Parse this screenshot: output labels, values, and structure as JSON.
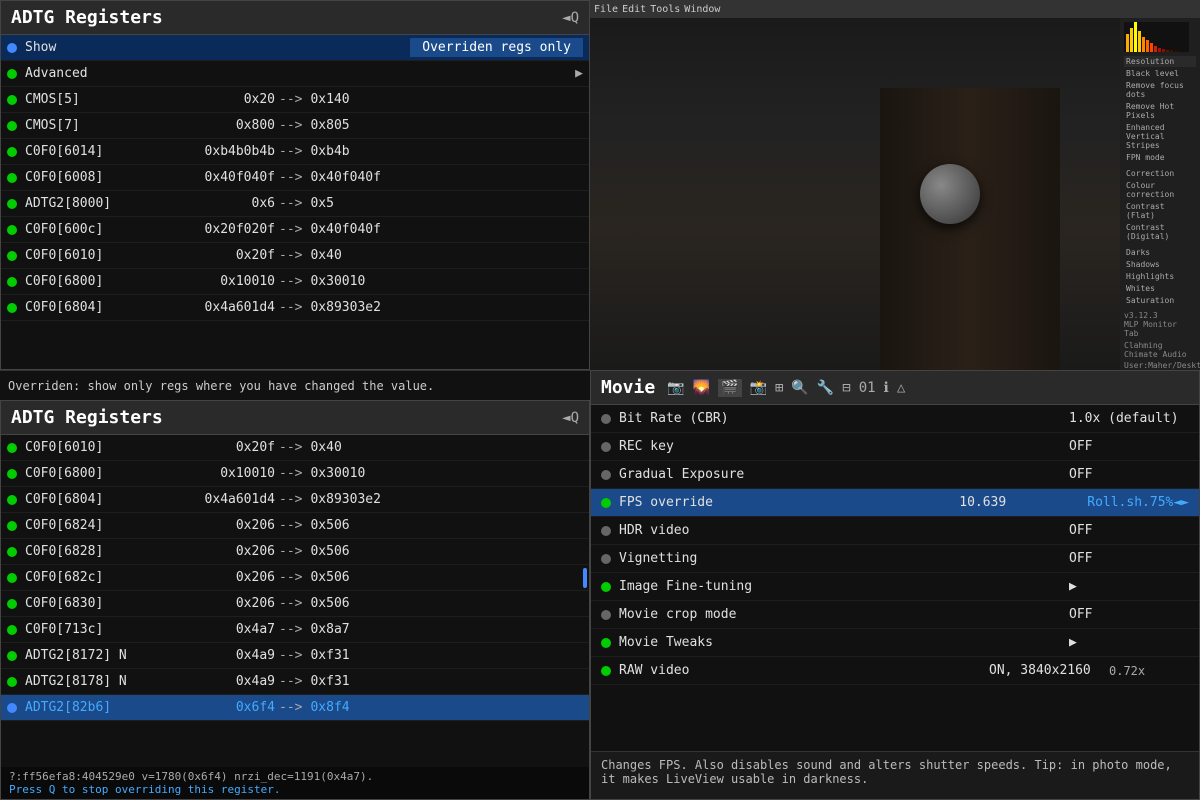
{
  "topLeft": {
    "title": "ADTG Registers",
    "icon": "◄Q",
    "showLabel": "Show",
    "showValue": "Overriden regs only",
    "advancedLabel": "Advanced",
    "registers": [
      {
        "dot": "green",
        "name": "CMOS[5]",
        "value": "0x20",
        "arrow": "-->",
        "override": "0x140"
      },
      {
        "dot": "green",
        "name": "CMOS[7]",
        "value": "0x800",
        "arrow": "-->",
        "override": "0x805"
      },
      {
        "dot": "green",
        "name": "C0F0[6014]",
        "value": "0xb4b0b4b",
        "arrow": "-->",
        "override": "0xb4b"
      },
      {
        "dot": "green",
        "name": "C0F0[6008]",
        "value": "0x40f040f",
        "arrow": "-->",
        "override": "0x40f040f"
      },
      {
        "dot": "green",
        "name": "ADTG2[8000]",
        "value": "0x6",
        "arrow": "-->",
        "override": "0x5"
      },
      {
        "dot": "green",
        "name": "C0F0[600c]",
        "value": "0x20f020f",
        "arrow": "-->",
        "override": "0x40f040f"
      },
      {
        "dot": "green",
        "name": "C0F0[6010]",
        "value": "0x20f",
        "arrow": "-->",
        "override": "0x40"
      },
      {
        "dot": "green",
        "name": "C0F0[6800]",
        "value": "0x10010",
        "arrow": "-->",
        "override": "0x30010"
      },
      {
        "dot": "green",
        "name": "C0F0[6804]",
        "value": "0x4a601d4",
        "arrow": "-->",
        "override": "0x89303e2"
      }
    ]
  },
  "statusBar": {
    "text": "Overriden: show only regs where you have changed the value."
  },
  "bottomLeft": {
    "title": "ADTG Registers",
    "icon": "◄Q",
    "registers": [
      {
        "dot": "green",
        "name": "C0F0[6010]",
        "value": "0x20f",
        "arrow": "-->",
        "override": "0x40"
      },
      {
        "dot": "green",
        "name": "C0F0[6800]",
        "value": "0x10010",
        "arrow": "-->",
        "override": "0x30010"
      },
      {
        "dot": "green",
        "name": "C0F0[6804]",
        "value": "0x4a601d4",
        "arrow": "-->",
        "override": "0x89303e2"
      },
      {
        "dot": "green",
        "name": "C0F0[6824]",
        "value": "0x206",
        "arrow": "-->",
        "override": "0x506"
      },
      {
        "dot": "green",
        "name": "C0F0[6828]",
        "value": "0x206",
        "arrow": "-->",
        "override": "0x506"
      },
      {
        "dot": "green",
        "name": "C0F0[682c]",
        "value": "0x206",
        "arrow": "-->",
        "override": "0x506"
      },
      {
        "dot": "green",
        "name": "C0F0[6830]",
        "value": "0x206",
        "arrow": "-->",
        "override": "0x506"
      },
      {
        "dot": "green",
        "name": "C0F0[713c]",
        "value": "0x4a7",
        "arrow": "-->",
        "override": "0x8a7"
      },
      {
        "dot": "green",
        "name": "ADTG2[8172] N",
        "value": "0x4a9",
        "arrow": "-->",
        "override": "0xf31"
      },
      {
        "dot": "green",
        "name": "ADTG2[8178] N",
        "value": "0x4a9",
        "arrow": "-->",
        "override": "0xf31"
      },
      {
        "dot": "blue",
        "name": "ADTG2[82b6]",
        "value": "0x6f4",
        "arrow": "-->",
        "override": "0x8f4",
        "selected": true
      }
    ],
    "bottomStatus": "?:ff56efa8:404529e0 v=1780(0x6f4) nrzi_dec=1191(0x4a7).",
    "pressQ": "Press Q to stop overriding this register."
  },
  "movie": {
    "title": "Movie",
    "icons": [
      "📷",
      "🖼",
      "🎬",
      "📸",
      "⊞",
      "📷",
      "🔧",
      "⊟",
      "01",
      "ℹ",
      "△"
    ],
    "rows": [
      {
        "dot": "gray",
        "label": "Bit Rate (CBR)",
        "value": "1.0x (default)",
        "extra": ""
      },
      {
        "dot": "gray",
        "label": "REC key",
        "value": "OFF",
        "extra": ""
      },
      {
        "dot": "gray",
        "label": "Gradual Exposure",
        "value": "OFF",
        "extra": ""
      },
      {
        "dot": "green",
        "label": "FPS override",
        "value": "10.639",
        "extra": "Roll.sh.75%◄►",
        "selected": true
      },
      {
        "dot": "gray",
        "label": "HDR video",
        "value": "OFF",
        "extra": ""
      },
      {
        "dot": "gray",
        "label": "Vignetting",
        "value": "OFF",
        "extra": ""
      },
      {
        "dot": "green",
        "label": "Image Fine-tuning",
        "value": "▶",
        "extra": ""
      },
      {
        "dot": "gray",
        "label": "Movie crop mode",
        "value": "OFF",
        "extra": ""
      },
      {
        "dot": "green",
        "label": "Movie Tweaks",
        "value": "▶",
        "extra": ""
      },
      {
        "dot": "green",
        "label": "RAW video",
        "value": "ON, 3840x2160",
        "extra": "0.72x"
      }
    ],
    "footer": "Changes FPS. Also disables sound and alters shutter speeds.\nTip: in photo mode, it makes LiveView usable in darkness."
  }
}
